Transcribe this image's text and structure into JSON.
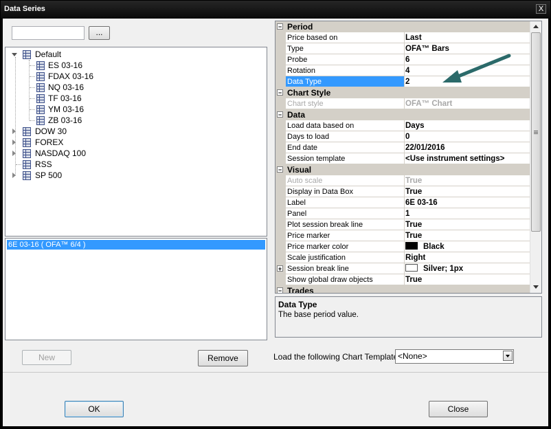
{
  "window": {
    "title": "Data Series",
    "close_label": "X"
  },
  "search": {
    "value": "",
    "browse_label": "..."
  },
  "tree": {
    "default": {
      "label": "Default",
      "children": [
        "ES 03-16",
        "FDAX 03-16",
        "NQ 03-16",
        "TF 03-16",
        "YM 03-16",
        "ZB 03-16"
      ]
    },
    "collapsed": [
      "DOW 30",
      "FOREX",
      "NASDAQ 100",
      "RSS",
      "SP 500"
    ]
  },
  "series_list": {
    "items": [
      "6E 03-16 ( OFA™ 6/4 )"
    ]
  },
  "buttons": {
    "new": "New",
    "remove": "Remove",
    "ok": "OK",
    "close": "Close"
  },
  "properties": {
    "period": {
      "category": "Period",
      "rows": [
        {
          "name": "Price based on",
          "value": "Last"
        },
        {
          "name": "Type",
          "value": "OFA™ Bars"
        },
        {
          "name": "Probe",
          "value": "6"
        },
        {
          "name": "Rotation",
          "value": "4"
        },
        {
          "name": "Data Type",
          "value": "2"
        }
      ]
    },
    "chart_style": {
      "category": "Chart Style",
      "rows": [
        {
          "name": "Chart style",
          "value": "OFA™ Chart"
        }
      ]
    },
    "data": {
      "category": "Data",
      "rows": [
        {
          "name": "Load data based on",
          "value": "Days"
        },
        {
          "name": "Days to load",
          "value": "0"
        },
        {
          "name": "End date",
          "value": "22/01/2016"
        },
        {
          "name": "Session template",
          "value": "<Use instrument settings>"
        }
      ]
    },
    "visual": {
      "category": "Visual",
      "rows": [
        {
          "name": "Auto scale",
          "value": "True"
        },
        {
          "name": "Display in Data Box",
          "value": "True"
        },
        {
          "name": "Label",
          "value": "6E 03-16"
        },
        {
          "name": "Panel",
          "value": "1"
        },
        {
          "name": "Plot session break line",
          "value": "True"
        },
        {
          "name": "Price marker",
          "value": "True"
        },
        {
          "name": "Price marker color",
          "value": "Black"
        },
        {
          "name": "Scale justification",
          "value": "Right"
        },
        {
          "name": "Session break line",
          "value": "Silver; 1px"
        },
        {
          "name": "Show global draw objects",
          "value": "True"
        }
      ]
    },
    "trades": {
      "category": "Trades"
    }
  },
  "colors": {
    "price_marker": "#000000",
    "session_break": "#c0c0c0",
    "selection": "#3399ff",
    "arrow": "#2b6a6a"
  },
  "description": {
    "title": "Data Type",
    "text": "The base period value."
  },
  "template": {
    "label": "Load the following Chart Template:",
    "value": "<None>"
  }
}
